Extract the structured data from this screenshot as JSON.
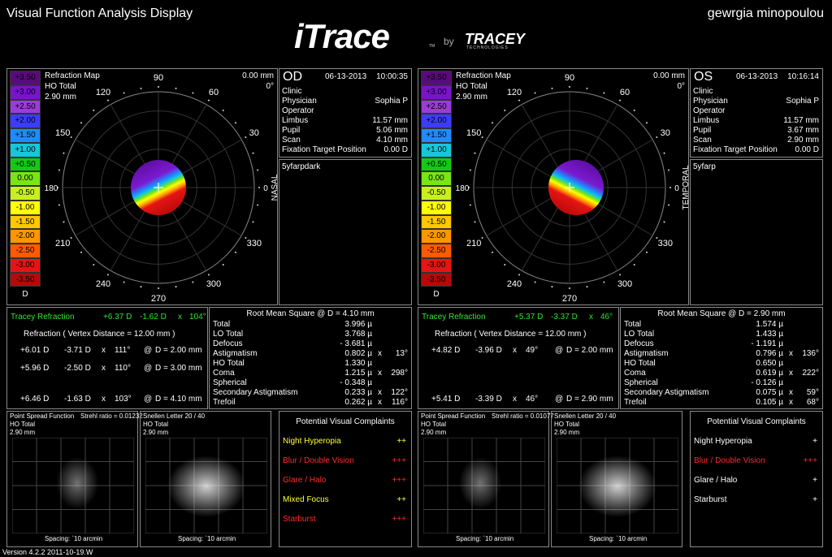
{
  "header": {
    "title": "Visual Function Analysis Display",
    "user": "gewrgia minopoulou",
    "logo_main": "iTrace",
    "logo_tm": "TM",
    "logo_by": "by",
    "logo_brand": "TRACEY",
    "logo_sub": "TECHNOLOGIES"
  },
  "legend": {
    "values": [
      "+3.50",
      "+3.00",
      "+2.50",
      "+2.00",
      "+1.50",
      "+1.00",
      "+0.50",
      "0.00",
      "-0.50",
      "-1.00",
      "-1.50",
      "-2.00",
      "-2.50",
      "-3.00",
      "-3.50"
    ],
    "colors": [
      "#5a0a7a",
      "#7a14c8",
      "#9a3cd8",
      "#3c3cff",
      "#1e8cff",
      "#14c8dc",
      "#14c814",
      "#78e614",
      "#c8f01e",
      "#ffff00",
      "#ffc800",
      "#ff9600",
      "#ff5a00",
      "#e61414",
      "#b40a0a"
    ],
    "unit": "D"
  },
  "eyes": [
    {
      "map": {
        "title": "Refraction Map",
        "sub": "HO Total",
        "size": "2.90 mm",
        "mm": "0.00 mm",
        "deg": "0°",
        "side_left": "TEMPORAL",
        "side_right": "NASAL",
        "axis_left": "180",
        "axis_right": "0",
        "angles": [
          "90",
          "60",
          "30",
          "330",
          "300",
          "270",
          "240",
          "210",
          "150",
          "120"
        ]
      },
      "info": {
        "eye": "OD",
        "date": "06-13-2013",
        "time": "10:00:35",
        "rows": [
          {
            "k": "Clinic",
            "v": ""
          },
          {
            "k": "Physician",
            "v": "Sophia P"
          },
          {
            "k": "Operator",
            "v": ""
          },
          {
            "k": "Limbus",
            "v": "11.57 mm"
          },
          {
            "k": "Pupil",
            "v": "5.06 mm"
          },
          {
            "k": "Scan",
            "v": "4.10 mm"
          },
          {
            "k": "Fixation Target Position",
            "v": "0.00 D"
          }
        ],
        "note": "5yfarpdark"
      },
      "refraction": {
        "tracey_label": "Tracey Refraction",
        "tracey_sph": "+6.37 D",
        "tracey_cyl": "-1.62 D",
        "tracey_x": "x",
        "tracey_axis": "104°",
        "title": "Refraction   ( Vertex Distance = 12.00 mm )",
        "rows": [
          {
            "sph": "+6.01 D",
            "cyl": "-3.71 D",
            "x": "x",
            "axis": "111°",
            "at": "@",
            "d": "D = 2.00 mm"
          },
          {
            "sph": "+5.96 D",
            "cyl": "-2.50 D",
            "x": "x",
            "axis": "110°",
            "at": "@",
            "d": "D = 3.00 mm"
          },
          {
            "sph": "+6.46 D",
            "cyl": "-1.63 D",
            "x": "x",
            "axis": "103°",
            "at": "@",
            "d": "D = 4.10 mm"
          }
        ]
      },
      "rms": {
        "title": "Root Mean Square @ D = 4.10 mm",
        "rows": [
          {
            "k": "Total",
            "v": "3.996 µ",
            "x": "",
            "a": ""
          },
          {
            "k": "LO Total",
            "v": "3.768 µ",
            "x": "",
            "a": ""
          },
          {
            "k": "Defocus",
            "v": "- 3.681 µ",
            "x": "",
            "a": ""
          },
          {
            "k": "Astigmatism",
            "v": "0.802 µ",
            "x": "x",
            "a": "13°"
          },
          {
            "k": "HO Total",
            "v": "1.330 µ",
            "x": "",
            "a": ""
          },
          {
            "k": "Coma",
            "v": "1.215 µ",
            "x": "x",
            "a": "298°"
          },
          {
            "k": "Spherical",
            "v": "- 0.348 µ",
            "x": "",
            "a": ""
          },
          {
            "k": "Secondary Astigmatism",
            "v": "0.233 µ",
            "x": "x",
            "a": "122°"
          },
          {
            "k": "Trefoil",
            "v": "0.262 µ",
            "x": "x",
            "a": "116°"
          }
        ]
      },
      "psf": {
        "title": "Point Spread Function",
        "strehl": "Strehl ratio = 0.01232",
        "sub": "HO Total",
        "size": "2.90 mm",
        "spacing": "Spacing: `10 arcmin"
      },
      "snellen": {
        "title": "Snellen Letter 20 / 40",
        "sub": "HO Total",
        "size": "2.90 mm",
        "spacing": "Spacing: `10 arcmin"
      },
      "complaints": {
        "title": "Potential Visual Complaints",
        "items": [
          {
            "label": "Night Hyperopia",
            "level": "++",
            "color": "#ffff33"
          },
          {
            "label": "Blur / Double Vision",
            "level": "+++",
            "color": "#ff2a2a"
          },
          {
            "label": "Glare / Halo",
            "level": "+++",
            "color": "#ff2a2a"
          },
          {
            "label": "Mixed Focus",
            "level": "++",
            "color": "#ffff33"
          },
          {
            "label": "Starburst",
            "level": "+++",
            "color": "#ff2a2a"
          }
        ]
      }
    },
    {
      "map": {
        "title": "Refraction Map",
        "sub": "HO Total",
        "size": "2.90 mm",
        "mm": "0.00 mm",
        "deg": "0°",
        "side_left": "NASAL",
        "side_right": "TEMPORAL",
        "axis_left": "180",
        "axis_right": "0",
        "angles": [
          "90",
          "60",
          "30",
          "330",
          "300",
          "270",
          "240",
          "210",
          "150",
          "120"
        ]
      },
      "info": {
        "eye": "OS",
        "date": "06-13-2013",
        "time": "10:16:14",
        "rows": [
          {
            "k": "Clinic",
            "v": ""
          },
          {
            "k": "Physician",
            "v": "Sophia P"
          },
          {
            "k": "Operator",
            "v": ""
          },
          {
            "k": "Limbus",
            "v": "11.57 mm"
          },
          {
            "k": "Pupil",
            "v": "3.67 mm"
          },
          {
            "k": "Scan",
            "v": "2.90 mm"
          },
          {
            "k": "Fixation Target Position",
            "v": "0.00 D"
          }
        ],
        "note": "5yfarp"
      },
      "refraction": {
        "tracey_label": "Tracey Refraction",
        "tracey_sph": "+5.37 D",
        "tracey_cyl": "-3.37 D",
        "tracey_x": "x",
        "tracey_axis": "46°",
        "title": "Refraction   ( Vertex Distance = 12.00 mm )",
        "rows": [
          {
            "sph": "+4.82 D",
            "cyl": "-3.96 D",
            "x": "x",
            "axis": "49°",
            "at": "@",
            "d": "D = 2.00 mm"
          },
          {
            "sph": "+5.41 D",
            "cyl": "-3.39 D",
            "x": "x",
            "axis": "46°",
            "at": "@",
            "d": "D = 2.90 mm"
          }
        ]
      },
      "rms": {
        "title": "Root Mean Square @ D = 2.90 mm",
        "rows": [
          {
            "k": "Total",
            "v": "1.574 µ",
            "x": "",
            "a": ""
          },
          {
            "k": "LO Total",
            "v": "1.433 µ",
            "x": "",
            "a": ""
          },
          {
            "k": "Defocus",
            "v": "- 1.191 µ",
            "x": "",
            "a": ""
          },
          {
            "k": "Astigmatism",
            "v": "0.796 µ",
            "x": "x",
            "a": "136°"
          },
          {
            "k": "HO Total",
            "v": "0.650 µ",
            "x": "",
            "a": ""
          },
          {
            "k": "Coma",
            "v": "0.619 µ",
            "x": "x",
            "a": "222°"
          },
          {
            "k": "Spherical",
            "v": "- 0.126 µ",
            "x": "",
            "a": ""
          },
          {
            "k": "Secondary Astigmatism",
            "v": "0.075 µ",
            "x": "x",
            "a": "59°"
          },
          {
            "k": "Trefoil",
            "v": "0.105 µ",
            "x": "x",
            "a": "68°"
          }
        ]
      },
      "psf": {
        "title": "Point Spread Function",
        "strehl": "Strehl ratio = 0.01077",
        "sub": "HO Total",
        "size": "2.90 mm",
        "spacing": "Spacing: `10 arcmin"
      },
      "snellen": {
        "title": "Snellen Letter 20 / 40",
        "sub": "HO Total",
        "size": "2.90 mm",
        "spacing": "Spacing: `10 arcmin"
      },
      "complaints": {
        "title": "Potential Visual Complaints",
        "items": [
          {
            "label": "Night Hyperopia",
            "level": "+",
            "color": "#ffffff"
          },
          {
            "label": "Blur / Double Vision",
            "level": "+++",
            "color": "#ff2a2a"
          },
          {
            "label": "Glare / Halo",
            "level": "+",
            "color": "#ffffff"
          },
          {
            "label": "Starburst",
            "level": "+",
            "color": "#ffffff"
          }
        ]
      }
    }
  ],
  "footer": {
    "version": "Version 4.2.2 2011-10-19.W"
  }
}
